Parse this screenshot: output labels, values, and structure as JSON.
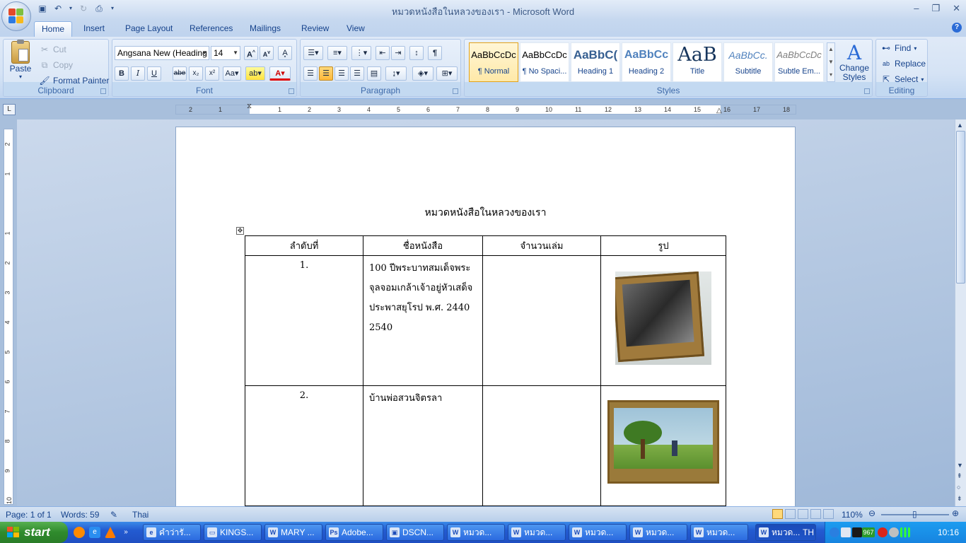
{
  "window": {
    "title": "หมวดหนังสือในหลวงของเรา - Microsoft Word",
    "controls": [
      "minimize-icon",
      "restore-icon",
      "close-icon"
    ]
  },
  "tabs": [
    {
      "label": "Home",
      "active": true
    },
    {
      "label": "Insert"
    },
    {
      "label": "Page Layout"
    },
    {
      "label": "References"
    },
    {
      "label": "Mailings"
    },
    {
      "label": "Review"
    },
    {
      "label": "View"
    }
  ],
  "ribbon": {
    "clipboard": {
      "label": "Clipboard",
      "paste": "Paste",
      "cut": "Cut",
      "copy": "Copy",
      "format_painter": "Format Painter"
    },
    "font": {
      "label": "Font",
      "name": "Angsana New (Heading",
      "size": "14"
    },
    "paragraph": {
      "label": "Paragraph"
    },
    "styles": {
      "label": "Styles",
      "items": [
        {
          "preview": "AaBbCcDc",
          "name": "¶ Normal"
        },
        {
          "preview": "AaBbCcDc",
          "name": "¶ No Spaci..."
        },
        {
          "preview": "AaBbC(",
          "name": "Heading 1"
        },
        {
          "preview": "AaBbCc",
          "name": "Heading 2"
        },
        {
          "preview": "AaB",
          "name": "Title"
        },
        {
          "preview": "AaBbCc.",
          "name": "Subtitle"
        },
        {
          "preview": "AaBbCcDc",
          "name": "Subtle Em..."
        }
      ],
      "change_styles": "Change Styles"
    },
    "editing": {
      "label": "Editing",
      "find": "Find",
      "replace": "Replace",
      "select": "Select"
    }
  },
  "ruler": {
    "ticks": [
      "2",
      "1",
      "1",
      "2",
      "3",
      "4",
      "5",
      "6",
      "7",
      "8",
      "9",
      "10",
      "11",
      "12",
      "13",
      "14",
      "15",
      "16",
      "17",
      "18"
    ],
    "vticks": [
      "2",
      "1",
      "1",
      "2",
      "3",
      "4",
      "5",
      "6",
      "7",
      "8",
      "9",
      "10"
    ]
  },
  "document": {
    "title": "หมวดหนังสือในหลวงของเรา",
    "table": {
      "headers": [
        "ลำดับที่",
        "ชื่อหนังสือ",
        "จำนวนเล่ม",
        "รูป"
      ],
      "rows": [
        {
          "no": "1.",
          "name": "100 ปีพระบาทสมเด็จพระจุลจอมเกล้าเจ้าอยู่หัวเสด็จประพาสยุโรป พ.ศ. 2440 2540",
          "qty": "",
          "image": "book-photo-1"
        },
        {
          "no": "2.",
          "name": "บ้านพ่อสวนจิตรลา",
          "qty": "",
          "image": "book-photo-2"
        }
      ]
    }
  },
  "status": {
    "page": "Page: 1 of 1",
    "words": "Words: 59",
    "language": "Thai",
    "zoom": "110%"
  },
  "taskbar": {
    "start": "start",
    "tasks": [
      "คำว่ารั...",
      "KINGS...",
      "MARY ...",
      "Adobe...",
      "DSCN...",
      "หมวด...",
      "หมวด...",
      "หมวด...",
      "หมวด...",
      "หมวด...",
      "หมวด..."
    ],
    "lang": "TH",
    "tray_counter": "967",
    "clock": "10:16"
  },
  "colors": {
    "accent": "#15428b",
    "ribbon": "#dbe7f6",
    "taskbar": "#235bd1",
    "start": "#3c9a38"
  }
}
